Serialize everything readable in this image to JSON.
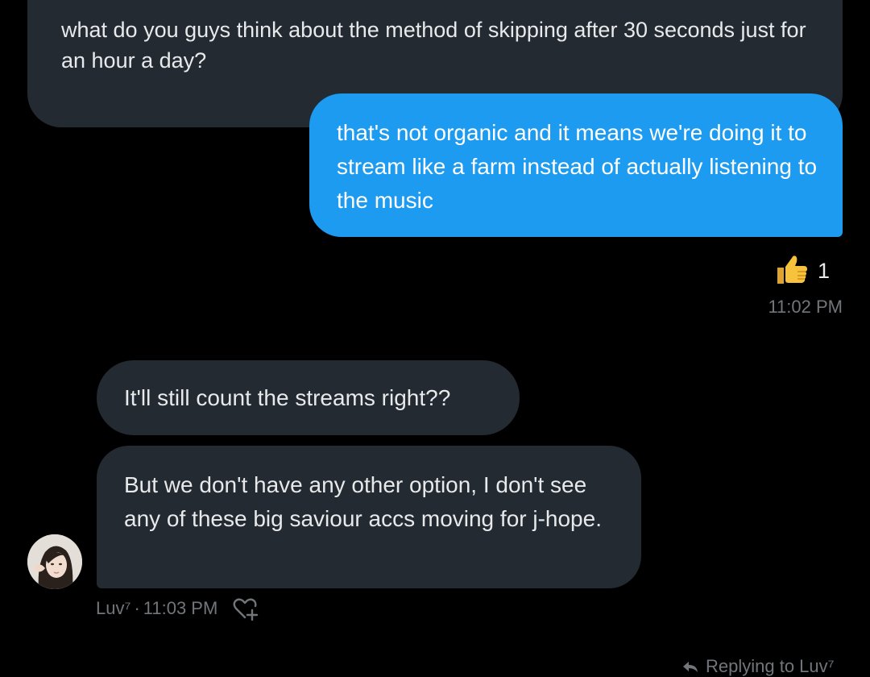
{
  "messages": {
    "top": {
      "text": "what do you guys think about the method of skipping after 30 seconds just for an hour a day?"
    },
    "outgoing": {
      "text": "that's not organic and it means we're doing it to stream like a farm instead of actually listening to the music",
      "reaction_emoji": "👍",
      "reaction_count": "1",
      "time": "11:02 PM"
    },
    "incoming_1": {
      "text": "It'll still count the streams right??"
    },
    "incoming_2": {
      "text": "But we don't have any other option, I don't see any of these big saviour accs moving for j-hope."
    }
  },
  "sender": {
    "name": "Luv⁷",
    "separator": "·",
    "time": "11:03 PM"
  },
  "reply_hint": "Replying to Luv⁷",
  "icons": {
    "reaction": "thumbs-up-icon",
    "add_reaction": "heart-plus-icon",
    "reply": "reply-arrow-icon",
    "avatar": "avatar-photo"
  },
  "colors": {
    "background": "#000000",
    "incoming_bubble": "#232a32",
    "outgoing_bubble": "#1d9bf0",
    "meta_text": "#71767b"
  }
}
